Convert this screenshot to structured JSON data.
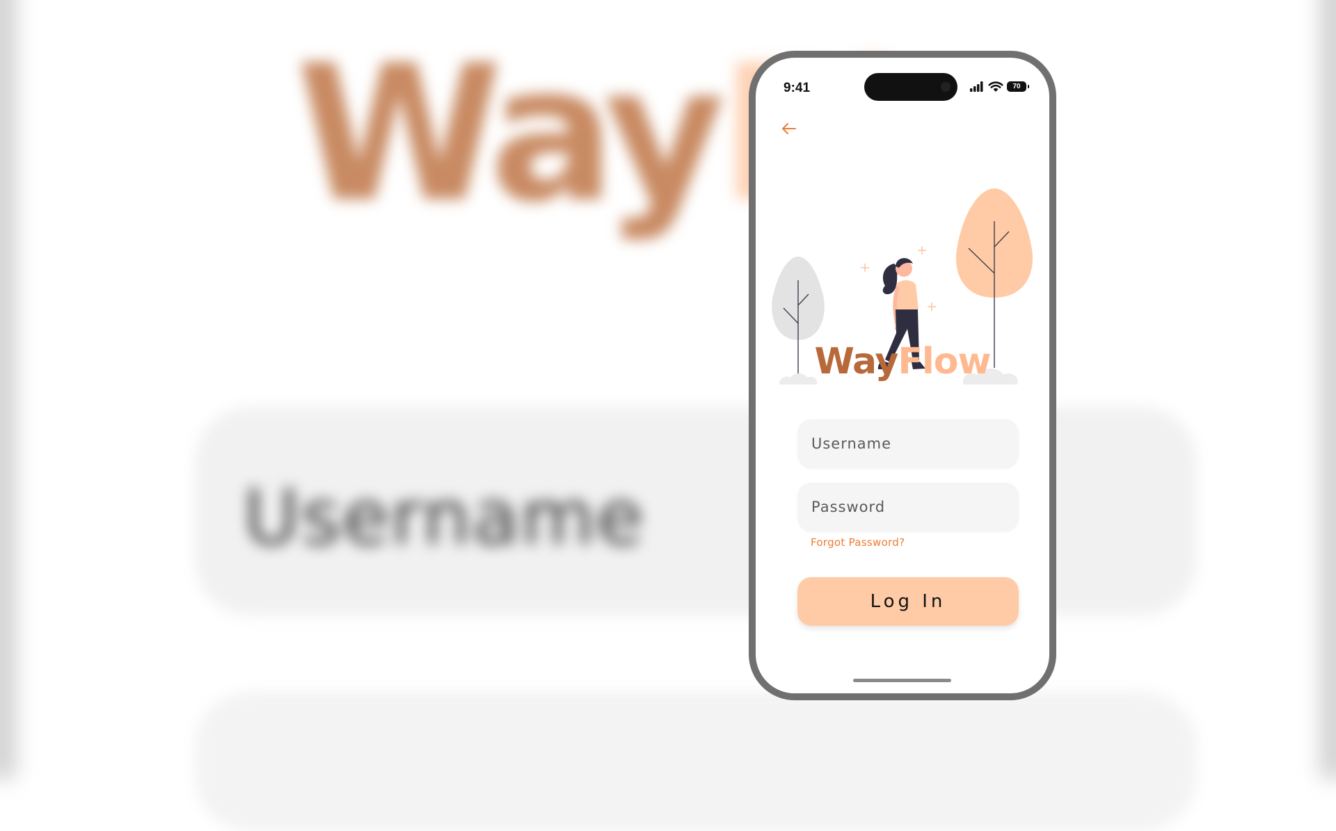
{
  "background": {
    "wordmark_part1": "Way",
    "wordmark_part2": "Fl",
    "field_text": "Username"
  },
  "status_bar": {
    "time": "9:41",
    "battery": "70"
  },
  "brand": {
    "part1": "Way",
    "part2": "Flow",
    "color_part1": "#b8693a",
    "color_part2": "#ffb990"
  },
  "form": {
    "username_placeholder": "Username",
    "password_placeholder": "Password",
    "forgot_label": "Forgot Password?",
    "login_label": "Log In"
  },
  "colors": {
    "accent": "#f07a33",
    "button": "#ffcba6",
    "tree_peach": "#ffcba6",
    "tree_grey": "#e3e3e3",
    "frame": "#707070"
  },
  "icons": {
    "back": "arrow-left-icon",
    "signal": "cellular-signal-icon",
    "wifi": "wifi-icon",
    "battery": "battery-icon"
  }
}
